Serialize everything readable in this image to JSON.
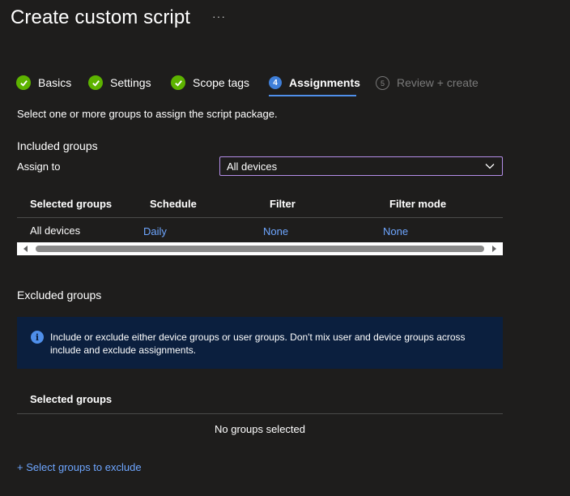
{
  "header": {
    "title": "Create custom script",
    "more_label": "···"
  },
  "wizard": {
    "steps": [
      {
        "label": "Basics",
        "state": "complete",
        "number": "1"
      },
      {
        "label": "Settings",
        "state": "complete",
        "number": "2"
      },
      {
        "label": "Scope tags",
        "state": "complete",
        "number": "3"
      },
      {
        "label": "Assignments",
        "state": "active",
        "number": "4"
      },
      {
        "label": "Review + create",
        "state": "pending",
        "number": "5"
      }
    ]
  },
  "assignments": {
    "intro": "Select one or more groups to assign the script package.",
    "included": {
      "heading": "Included groups",
      "assign_to_label": "Assign to",
      "assign_to_value": "All devices",
      "columns": [
        "Selected groups",
        "Schedule",
        "Filter",
        "Filter mode"
      ],
      "rows": [
        {
          "group": "All devices",
          "schedule": "Daily",
          "filter": "None",
          "filter_mode": "None"
        }
      ]
    },
    "excluded": {
      "heading": "Excluded groups",
      "info_text": "Include or exclude either device groups or user groups. Don't mix user and device groups across include and exclude assignments.",
      "columns": [
        "Selected groups"
      ],
      "empty_text": "No groups selected",
      "select_link": "+ Select groups to exclude"
    }
  },
  "colors": {
    "background": "#1e1d1c",
    "complete": "#5db300",
    "active": "#3f7fd9",
    "link": "#6ea6ff",
    "info_bg": "#0b1f3e",
    "dropdown_border": "#b48ee8"
  },
  "icons": {
    "complete": "checkmark-circle-icon",
    "info": "info-icon",
    "dropdown": "chevron-down-icon"
  }
}
